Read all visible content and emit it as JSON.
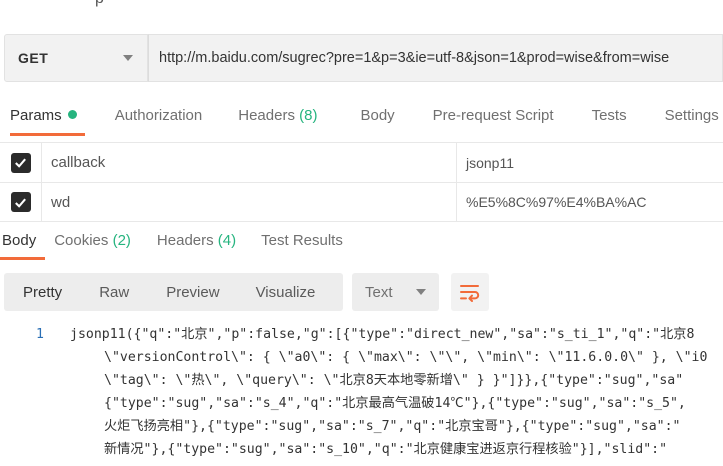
{
  "top_fragment": "p",
  "request": {
    "method": "GET",
    "url": "http://m.baidu.com/sugrec?pre=1&p=3&ie=utf-8&json=1&prod=wise&from=wise"
  },
  "request_tabs": [
    {
      "label": "Params",
      "count": ""
    },
    {
      "label": "Authorization",
      "count": ""
    },
    {
      "label": "Headers",
      "count": "(8)"
    },
    {
      "label": "Body",
      "count": ""
    },
    {
      "label": "Pre-request Script",
      "count": ""
    },
    {
      "label": "Tests",
      "count": ""
    },
    {
      "label": "Settings",
      "count": ""
    }
  ],
  "params": [
    {
      "key": "callback",
      "value": "jsonp11",
      "checked": true
    },
    {
      "key": "wd",
      "value": "%E5%8C%97%E4%BA%AC",
      "checked": true
    }
  ],
  "response_tabs": [
    {
      "label": "Body",
      "count": ""
    },
    {
      "label": "Cookies",
      "count": "(2)"
    },
    {
      "label": "Headers",
      "count": "(4)"
    },
    {
      "label": "Test Results",
      "count": ""
    }
  ],
  "view_modes": [
    "Pretty",
    "Raw",
    "Preview",
    "Visualize"
  ],
  "format": "Text",
  "colors": {
    "accent": "#f26b3a",
    "success": "#26b47f",
    "line_number": "#2a6fb5"
  },
  "code": {
    "line_number": "1",
    "lines": [
      "jsonp11({\"q\":\"北京\",\"p\":false,\"g\":[{\"type\":\"direct_new\",\"sa\":\"s_ti_1\",\"q\":\"北京8",
      "\\\"versionControl\\\": { \\\"a0\\\": { \\\"max\\\": \\\"\\\", \\\"min\\\": \\\"11.6.0.0\\\" }, \\\"i0",
      "\\\"tag\\\": \\\"热\\\", \\\"query\\\": \\\"北京8天本地零新增\\\" } }\"]}},{\"type\":\"sug\",\"sa\"",
      "{\"type\":\"sug\",\"sa\":\"s_4\",\"q\":\"北京最高气温破14℃\"},{\"type\":\"sug\",\"sa\":\"s_5\",",
      "火炬飞扬亮相\"},{\"type\":\"sug\",\"sa\":\"s_7\",\"q\":\"北京宝哥\"},{\"type\":\"sug\",\"sa\":\"",
      "新情况\"},{\"type\":\"sug\",\"sa\":\"s_10\",\"q\":\"北京健康宝进返京行程核验\"}],\"slid\":\""
    ]
  }
}
